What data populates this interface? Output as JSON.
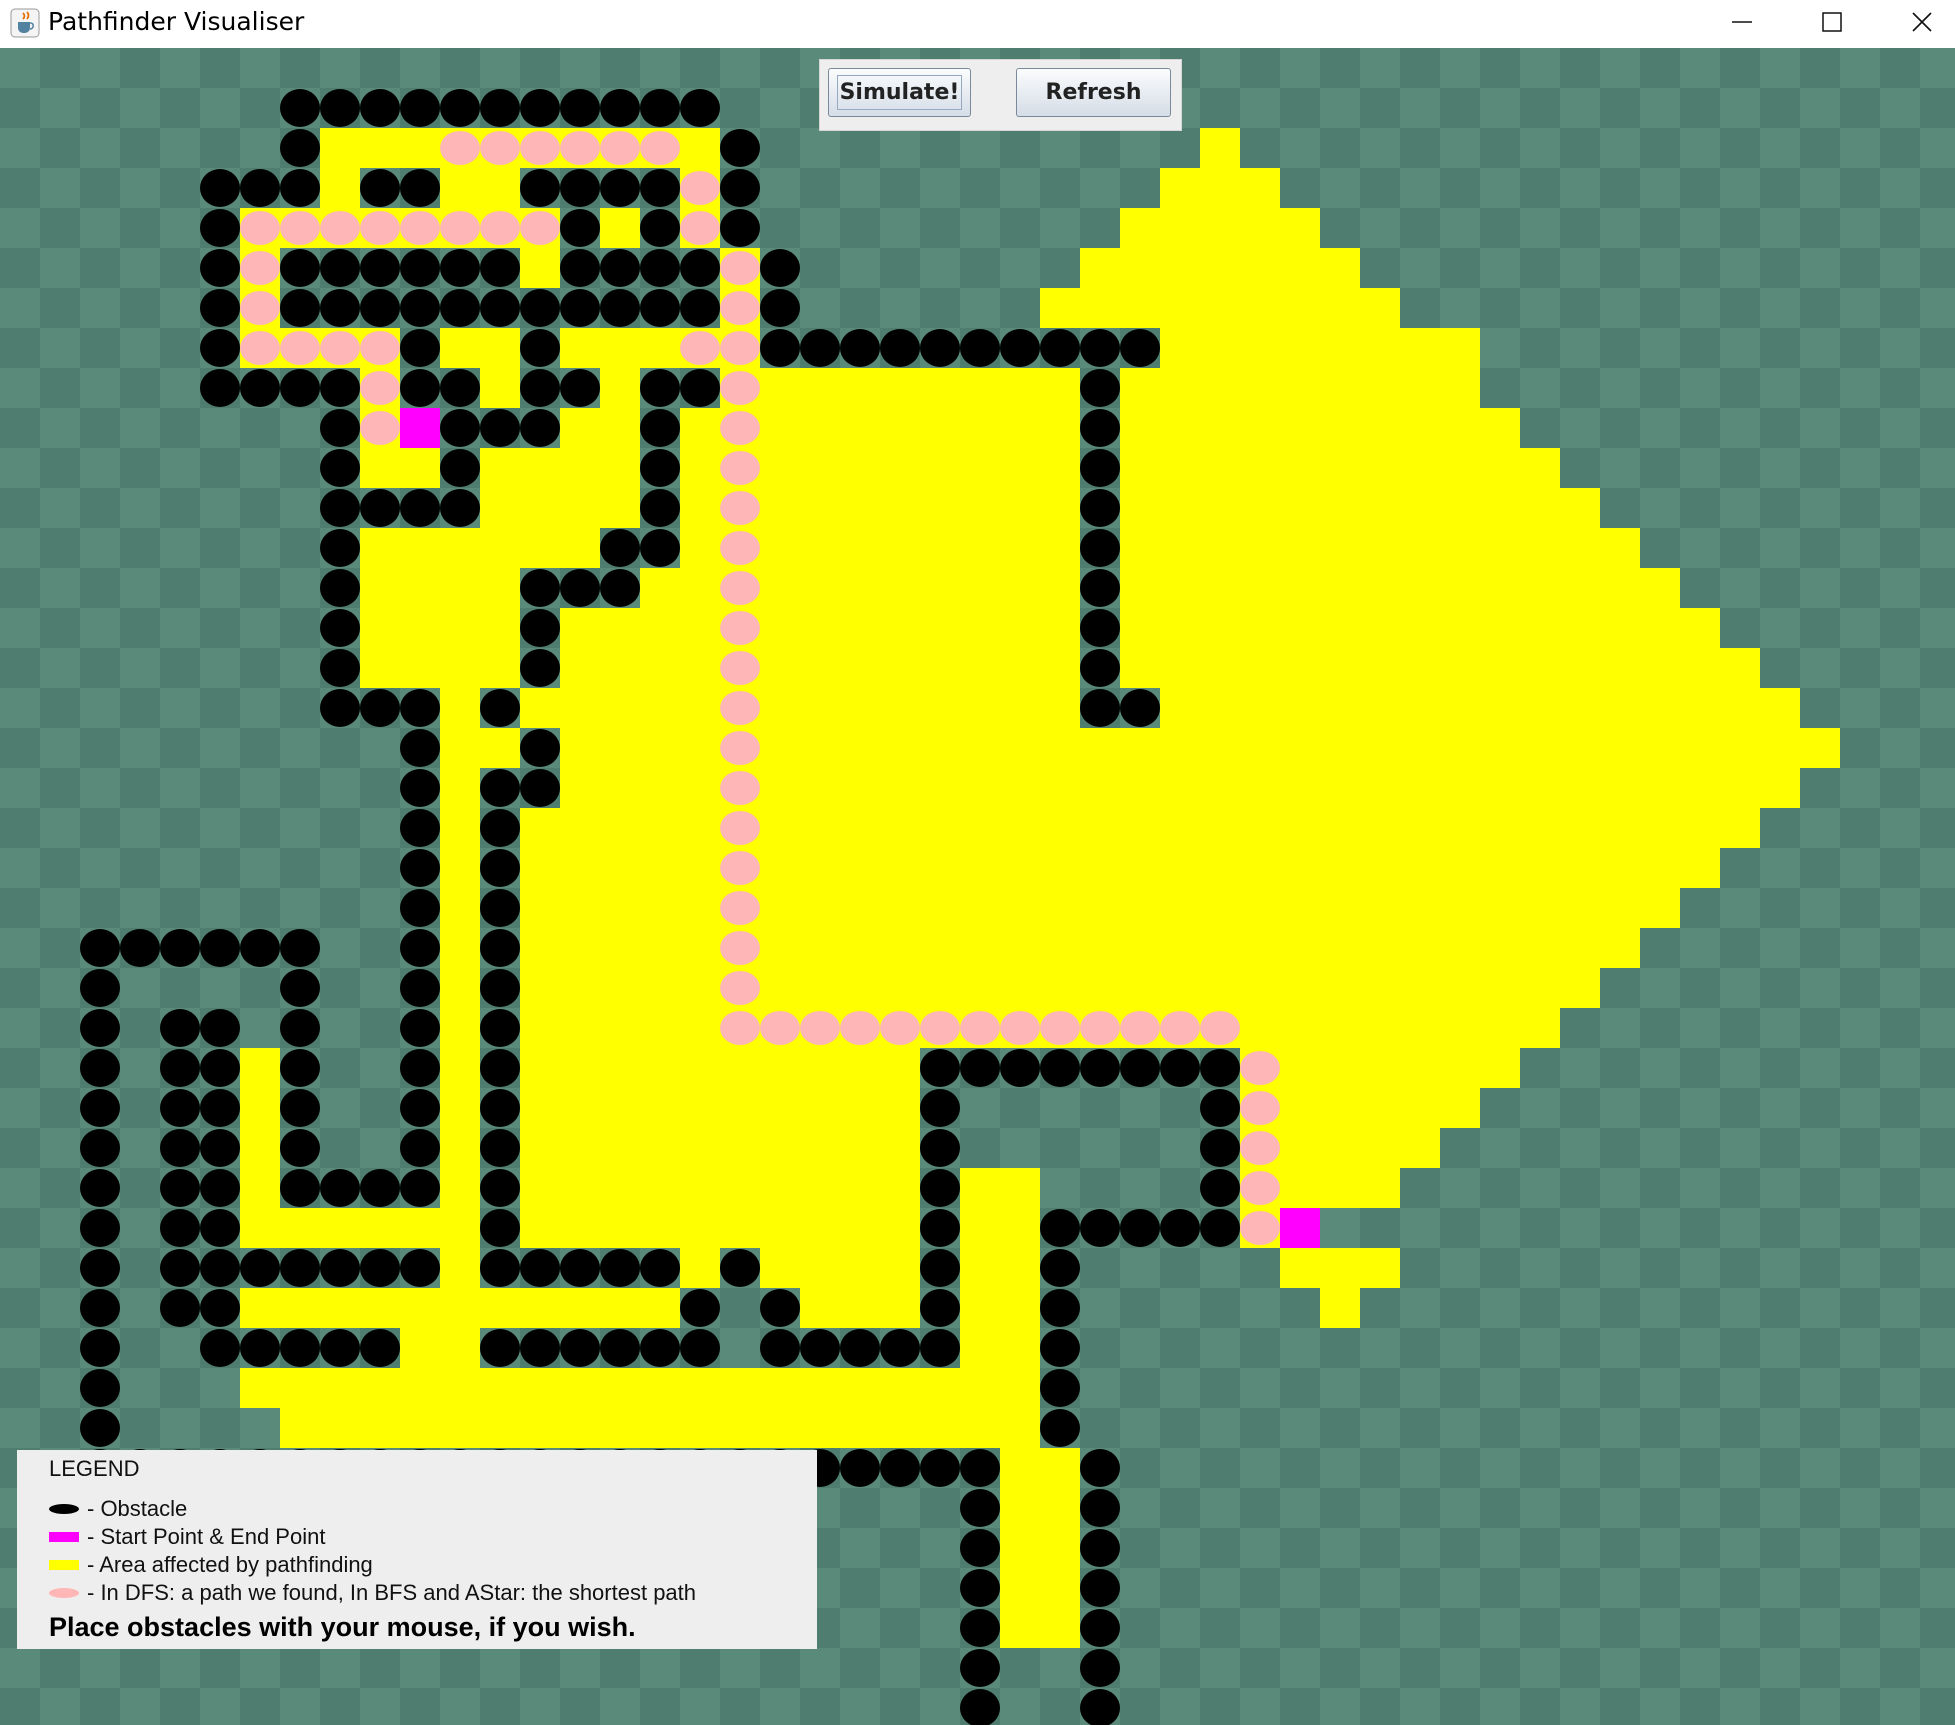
{
  "window": {
    "title": "Pathfinder Visualiser",
    "icon": "java-cup-icon",
    "controls": [
      "minimize-icon",
      "maximize-icon",
      "close-icon"
    ]
  },
  "toolbar": {
    "simulate_label": "Simulate!",
    "refresh_label": "Refresh"
  },
  "legend": {
    "title": "LEGEND",
    "obstacle": "- Obstacle",
    "start_end": "- Start Point & End Point",
    "area": "- Area affected by pathfinding",
    "path": "- In DFS: a path we found, In BFS and AStar: the shortest path",
    "hint": "Place obstacles with your mouse, if you wish."
  },
  "colors": {
    "bg_a": "#5a8a7a",
    "bg_b": "#4f7d70",
    "obstacle": "#000000",
    "endpoint": "#ff00ff",
    "area": "#ffff00",
    "path": "#ffb6b6"
  },
  "grid": {
    "legend": ". empty, # obstacle, Y area, P path, S start/end",
    "rows": [
      ".................................................",
      ".......###########...............................",
      ".......#YYYPPPPPPY#...........Y..................",
      ".....###Y##YY####P#..........YYY.................",
      ".....#PPPPPPPP#Y#P#.........YYYYY................",
      ".....#P######Y####P#.......YYYYYYY...............",
      ".....#P###########P#......YYYYYYYYY..............",
      ".....#PPPP#YY#YYYPP##########YYYYYYYY............",
      ".....####P##Y##Y##PYYYYYYYY#YYYYYYYYY............",
      "........#PS###YY#YPYYYYYYYY#YYYYYYYYYY...........",
      "........#YY#YYYY#YPYYYYYYYY#YYYYYYYYYYY..........",
      "........####YYYY#YPYYYYYYYY#YYYYYYYYYYYY.........",
      "........#YYYYYY##YPYYYYYYYY#YYYYYYYYYYYYY........",
      "........#YYYY###YYPYYYYYYYY#YYYYYYYYYYYYYY.......",
      "........#YYYY#YYYYPYYYYYYYY#YYYYYYYYYYYYYYY......",
      "........#YYYY#YYYYPYYYYYYYY#YYYYYYYYYYYYYYYY.....",
      "........###Y#YYYYYPYYYYYYYY##YYYYYYYYYYYYYYYY....",
      "..........#YY#YYYYPYYYYYYYYYYYYYYYYYYYYYYYYYYY...",
      "..........#Y##YYYYPYYYYYYYYYYYYYYYYYYYYYYYYYY....",
      "..........#Y#YYYYYPYYYYYYYYYYYYYYYYYYYYYYYYY.....",
      "..........#Y#YYYYYPYYYYYYYYYYYYYYYYYYYYYYYY......",
      "..........#Y#YYYYYPYYYYYYYYYYYYYYYYYYYYYYY.......",
      "..######..#Y#YYYYYPYYYYYYYYYYYYYYYYYYYYYY........",
      "..#....#..#Y#YYYYYPYYYYYYYYYYYYYYYYYYYYY.........",
      "..#.##.#..#Y#YYYYYPPPPPPPPPPPPPYYYYYYYY..........",
      "..#.##Y#..#Y#YYYYYYYYYY########PYYYYYY...........",
      "..#.##Y#..#Y#YYYYYYYYYY#......#PYYYYY............",
      "..#.##Y#..#Y#YYYYYYYYYY#......#PYYYY.............",
      "..#.##Y####Y#YYYYYYYYYY#YY....#PYYY..............",
      "..#.##YYYYYY#YYYYYYYYYY#YY#####PS................",
      "..#.#######Y#####Y#YYYY#YY#.....YYY..............",
      "..#.##YYYYYYYYYYY#.#YYY#YY#......Y...............",
      "..#..#####YY######.#####YY#......................",
      "..#...YYYYYYYYYYYYYYYYYYYY#......................",
      "..#....YYYYYYYYYYYYYYYYYYY#......................",
      "..#######################YY#.....................",
      "........................#YY#.....................",
      "........................#YY#.....................",
      "........................#YY#.....................",
      "........................#YY#.....................",
      "........................#..#.....................",
      "........................#..#.....................",
      "........................#..#.....................",
      "................................................."
    ]
  }
}
